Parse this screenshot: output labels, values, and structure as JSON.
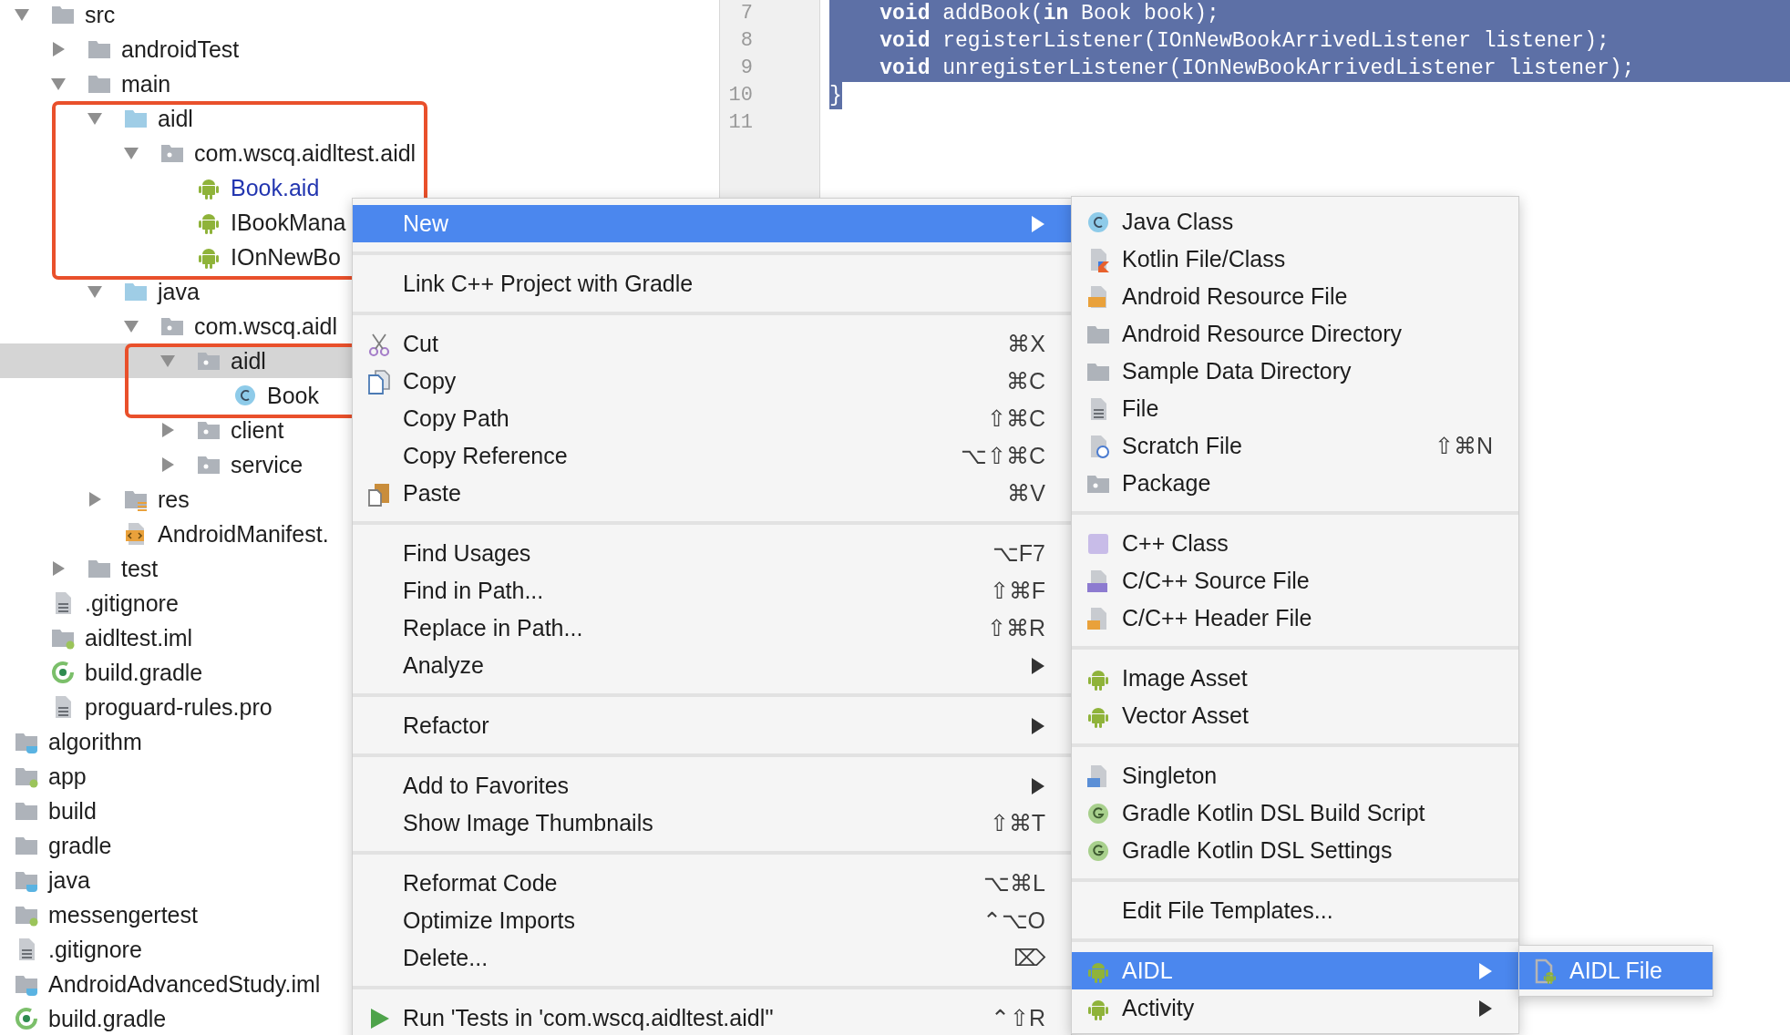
{
  "tree": {
    "nested_items": [
      {
        "label": "src",
        "kind": "folder",
        "expanded": true,
        "children": [
          {
            "label": "androidTest",
            "kind": "folder",
            "expanded": false
          },
          {
            "label": "main",
            "kind": "folder",
            "expanded": true,
            "children": [
              {
                "label": "aidl",
                "kind": "source-folder",
                "expanded": true,
                "boxed": true,
                "children": [
                  {
                    "label": "com.wscq.aidltest.aidl",
                    "kind": "package",
                    "expanded": true,
                    "children": [
                      {
                        "label": "Book.aid",
                        "kind": "android",
                        "modified": true
                      },
                      {
                        "label": "IBookMana",
                        "kind": "android",
                        "modified": false
                      },
                      {
                        "label": "IOnNewBo",
                        "kind": "android",
                        "modified": false
                      }
                    ]
                  }
                ]
              },
              {
                "label": "java",
                "kind": "source-folder",
                "expanded": true,
                "children": [
                  {
                    "label": "com.wscq.aidl",
                    "kind": "package",
                    "expanded": true,
                    "children": [
                      {
                        "label": "aidl",
                        "kind": "package",
                        "expanded": true,
                        "selected": true,
                        "boxed": true,
                        "children": [
                          {
                            "label": "Book",
                            "kind": "class"
                          }
                        ]
                      },
                      {
                        "label": "client",
                        "kind": "package",
                        "expanded": false
                      },
                      {
                        "label": "service",
                        "kind": "package",
                        "expanded": false
                      }
                    ]
                  }
                ]
              },
              {
                "label": "res",
                "kind": "res-folder",
                "expanded": false
              },
              {
                "label": "AndroidManifest.",
                "kind": "manifest"
              }
            ]
          },
          {
            "label": "test",
            "kind": "folder",
            "expanded": false
          }
        ]
      },
      {
        "label": ".gitignore",
        "kind": "file"
      },
      {
        "label": "aidltest.iml",
        "kind": "module"
      },
      {
        "label": "build.gradle",
        "kind": "gradle"
      },
      {
        "label": "proguard-rules.pro",
        "kind": "file"
      }
    ],
    "items": [
      {
        "label": "algorithm",
        "kind": "java-module"
      },
      {
        "label": "app",
        "kind": "module"
      },
      {
        "label": "build",
        "kind": "folder"
      },
      {
        "label": "gradle",
        "kind": "folder"
      },
      {
        "label": "java",
        "kind": "java-module"
      },
      {
        "label": "messengertest",
        "kind": "module"
      },
      {
        "label": ".gitignore",
        "kind": "file"
      },
      {
        "label": "AndroidAdvancedStudy.iml",
        "kind": "java-module"
      },
      {
        "label": "build.gradle",
        "kind": "gradle"
      }
    ]
  },
  "editor": {
    "lines": [
      {
        "number": "7",
        "text": "    **void** addBook(**in** Book book);",
        "selected": true
      },
      {
        "number": "8",
        "text": "    **void** registerListener(IOnNewBookArrivedListener listener);",
        "selected": true
      },
      {
        "number": "9",
        "text": "    **void** unregisterListener(IOnNewBookArrivedListener listener);",
        "selected": true
      },
      {
        "number": "10",
        "text": "}",
        "selected": true
      },
      {
        "number": "11"
      }
    ]
  },
  "context_menu": {
    "groups": [
      [
        {
          "label": "New",
          "submenu": true,
          "selected": true
        }
      ],
      [
        {
          "label": "Link C++ Project with Gradle",
          "selected": false
        }
      ],
      [
        {
          "label": "Cut",
          "kind": "scissors",
          "shortcut": "⌘X",
          "selected": false
        },
        {
          "label": "Copy",
          "kind": "copy",
          "shortcut": "⌘C",
          "selected": false
        },
        {
          "label": "Copy Path",
          "shortcut": "⇧⌘C",
          "selected": false
        },
        {
          "label": "Copy Reference",
          "shortcut": "⌥⇧⌘C",
          "selected": false
        },
        {
          "label": "Paste",
          "kind": "paste",
          "shortcut": "⌘V",
          "selected": false
        }
      ],
      [
        {
          "label": "Find Usages",
          "shortcut": "⌥F7",
          "selected": false
        },
        {
          "label": "Find in Path...",
          "shortcut": "⇧⌘F",
          "selected": false
        },
        {
          "label": "Replace in Path...",
          "shortcut": "⇧⌘R",
          "selected": false
        },
        {
          "label": "Analyze",
          "submenu": true,
          "selected": false
        }
      ],
      [
        {
          "label": "Refactor",
          "submenu": true,
          "selected": false
        }
      ],
      [
        {
          "label": "Add to Favorites",
          "submenu": true,
          "selected": false
        },
        {
          "label": "Show Image Thumbnails",
          "shortcut": "⇧⌘T",
          "selected": false
        }
      ],
      [
        {
          "label": "Reformat Code",
          "shortcut": "⌥⌘L",
          "selected": false
        },
        {
          "label": "Optimize Imports",
          "shortcut": "⌃⌥O",
          "selected": false
        },
        {
          "label": "Delete...",
          "shortcut": "⌦",
          "selected": false
        }
      ],
      [
        {
          "label": "Run 'Tests in 'com.wscq.aidltest.aidl''",
          "kind": "run",
          "shortcut": "⌃⇧R",
          "selected": false
        }
      ]
    ]
  },
  "new_submenu": {
    "groups": [
      [
        {
          "label": "Java Class",
          "kind": "class",
          "selected": false
        },
        {
          "label": "Kotlin File/Class",
          "kind": "kotlin",
          "selected": false
        },
        {
          "label": "Android Resource File",
          "kind": "resource-file",
          "selected": false
        },
        {
          "label": "Android Resource Directory",
          "kind": "folder",
          "selected": false
        },
        {
          "label": "Sample Data Directory",
          "kind": "folder",
          "selected": false
        },
        {
          "label": "File",
          "kind": "file",
          "selected": false
        },
        {
          "label": "Scratch File",
          "kind": "scratch",
          "shortcut": "⇧⌘N",
          "selected": false
        },
        {
          "label": "Package",
          "kind": "package",
          "selected": false
        }
      ],
      [
        {
          "label": "C++ Class",
          "kind": "cpp-class",
          "selected": false
        },
        {
          "label": "C/C++ Source File",
          "kind": "cpp-source",
          "selected": false
        },
        {
          "label": "C/C++ Header File",
          "kind": "cpp-header",
          "selected": false
        }
      ],
      [
        {
          "label": "Image Asset",
          "kind": "android",
          "selected": false
        },
        {
          "label": "Vector Asset",
          "kind": "android",
          "selected": false
        }
      ],
      [
        {
          "label": "Singleton",
          "kind": "singleton",
          "selected": false
        },
        {
          "label": "Gradle Kotlin DSL Build Script",
          "kind": "gradle-g",
          "selected": false
        },
        {
          "label": "Gradle Kotlin DSL Settings",
          "kind": "gradle-g",
          "selected": false
        }
      ],
      [
        {
          "label": "Edit File Templates...",
          "selected": false
        }
      ],
      [
        {
          "label": "AIDL",
          "kind": "android",
          "submenu": true,
          "selected": true
        },
        {
          "label": "Activity",
          "kind": "android",
          "submenu": true,
          "selected": false
        }
      ]
    ]
  },
  "aidl_submenu": {
    "groups": [
      [
        {
          "label": "AIDL File",
          "kind": "aidl-file",
          "selected": true
        }
      ]
    ]
  }
}
